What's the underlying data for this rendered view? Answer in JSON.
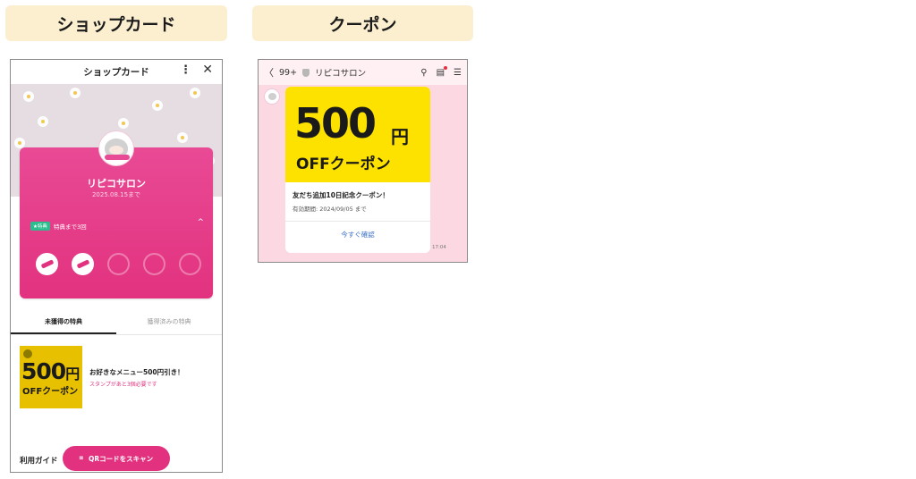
{
  "headers": {
    "shop_card": "ショップカード",
    "coupon": "クーポン"
  },
  "shop_card": {
    "title": "ショップカード",
    "more_icon": "⋮",
    "close_icon": "✕",
    "shop_name": "リピコサロン",
    "expiry": "2025.08.15まで",
    "perk_badge": "★特典",
    "perk_text": "特典まで3回",
    "chevron_icon": "^",
    "stamps_total": 5,
    "stamps_done": 2,
    "tabs": [
      {
        "label": "未獲得の特典",
        "active": true
      },
      {
        "label": "獲得済みの特典",
        "active": false
      }
    ],
    "reward": {
      "image_number": "500",
      "image_yen": "円",
      "image_off": "OFFクーポン",
      "title": "お好きなメニュー500円引き！",
      "note": "スタンプがあと3個必要です"
    },
    "guide_label": "利用ガイド",
    "qr_icon": "⌗",
    "qr_button": "QRコードをスキャン"
  },
  "coupon_chat": {
    "back_icon": "〈",
    "unread": "99+",
    "account_name": "リピコサロン",
    "search_icon": "⚲",
    "note_icon": "▤",
    "menu_icon": "☰",
    "coupon": {
      "number": "500",
      "yen": "円",
      "off": "OFFクーポン",
      "title": "友だち追加10日記念クーポン！",
      "period": "有効期間: 2024/09/05 まで",
      "button": "今すぐ確認"
    },
    "time": "17:04"
  },
  "colors": {
    "pink": "#e2327f",
    "yellow": "#fde200",
    "header_bg": "#fcefd0",
    "chat_bg": "#fcd8e3"
  }
}
